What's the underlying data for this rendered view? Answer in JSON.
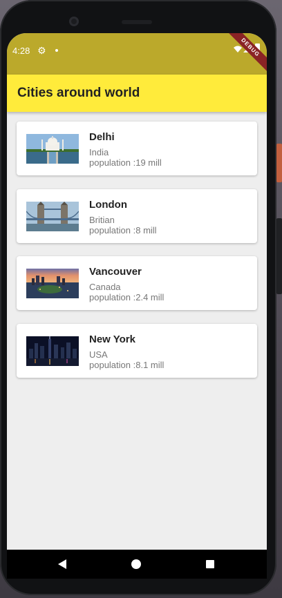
{
  "status": {
    "time": "4:28",
    "icons": [
      "gear-icon",
      "dot-icon",
      "wifi-icon",
      "signal-icon",
      "battery-icon"
    ]
  },
  "debug_banner": "DEBUG",
  "appbar": {
    "title": "Cities around world"
  },
  "cities": [
    {
      "name": "Delhi",
      "country": "India",
      "population": "population :19 mill",
      "image": "taj-mahal-image"
    },
    {
      "name": "London",
      "country": "Britian",
      "population": "population :8 mill",
      "image": "tower-bridge-image"
    },
    {
      "name": "Vancouver",
      "country": "Canada",
      "population": "population :2.4 mill",
      "image": "vancouver-skyline-image"
    },
    {
      "name": "New York",
      "country": "USA",
      "population": "population :8.1 mill",
      "image": "new-york-night-image"
    }
  ],
  "colors": {
    "appbar": "#ffeb3b",
    "statusbar": "#bba92b",
    "background": "#eeeeee",
    "card": "#ffffff",
    "debug": "#8a2325"
  },
  "navbar": {
    "icons": [
      "back-icon",
      "home-icon",
      "recents-icon"
    ]
  }
}
